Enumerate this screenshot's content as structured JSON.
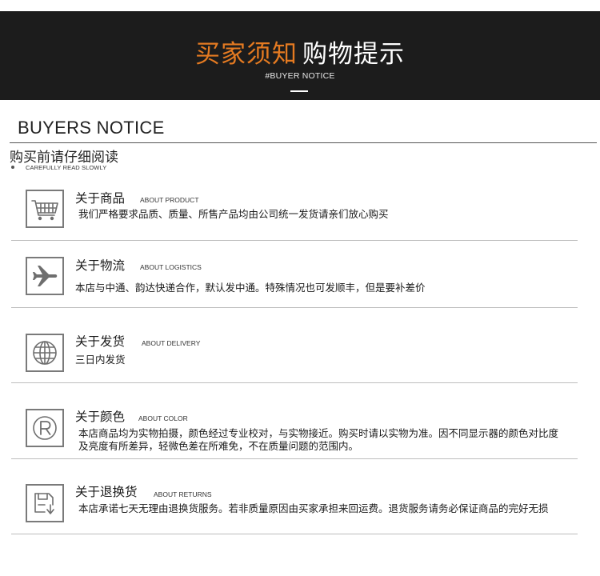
{
  "banner": {
    "title_highlight": "买家须知",
    "title_rest": "购物提示",
    "subtitle": "#BUYER NOTICE",
    "colors": {
      "background": "#1c1c1c",
      "accent": "#e47a21",
      "text": "#ffffff"
    }
  },
  "heading": {
    "title_en": "BUYERS NOTICE",
    "title_cn": "购买前请仔细阅读",
    "subtitle": "CAREFULLY READ SLOWLY"
  },
  "items": [
    {
      "title": "关于商品",
      "title_en": "ABOUT PRODUCT",
      "icon": "shopping-cart-icon",
      "desc": "我们严格要求品质、质量、所售产品均由公司统一发货请亲们放心购买"
    },
    {
      "title": "关于物流",
      "title_en": "ABOUT LOGISTICS",
      "icon": "airplane-icon",
      "desc": "本店与中通、韵达快递合作，默认发中通。特殊情况也可发顺丰，但是要补差价"
    },
    {
      "title": "关于发货",
      "title_en": "ABOUT DELIVERY",
      "icon": "globe-icon",
      "desc": "三日内发货"
    },
    {
      "title": "关于颜色",
      "title_en": "ABOUT COLOR",
      "icon": "registered-mark-icon",
      "desc": "本店商品均为实物拍摄，颜色经过专业校对，与实物接近。购买时请以实物为准。因不同显示器的颜色对比度及亮度有所差异，轻微色差在所难免，不在质量问题的范围内。"
    },
    {
      "title": "关于退换货",
      "title_en": "ABOUT RETURNS",
      "icon": "return-box-icon",
      "desc": "本店承诺七天无理由退换货服务。若非质量原因由买家承担来回运费。退货服务请务必保证商品的完好无损"
    }
  ]
}
